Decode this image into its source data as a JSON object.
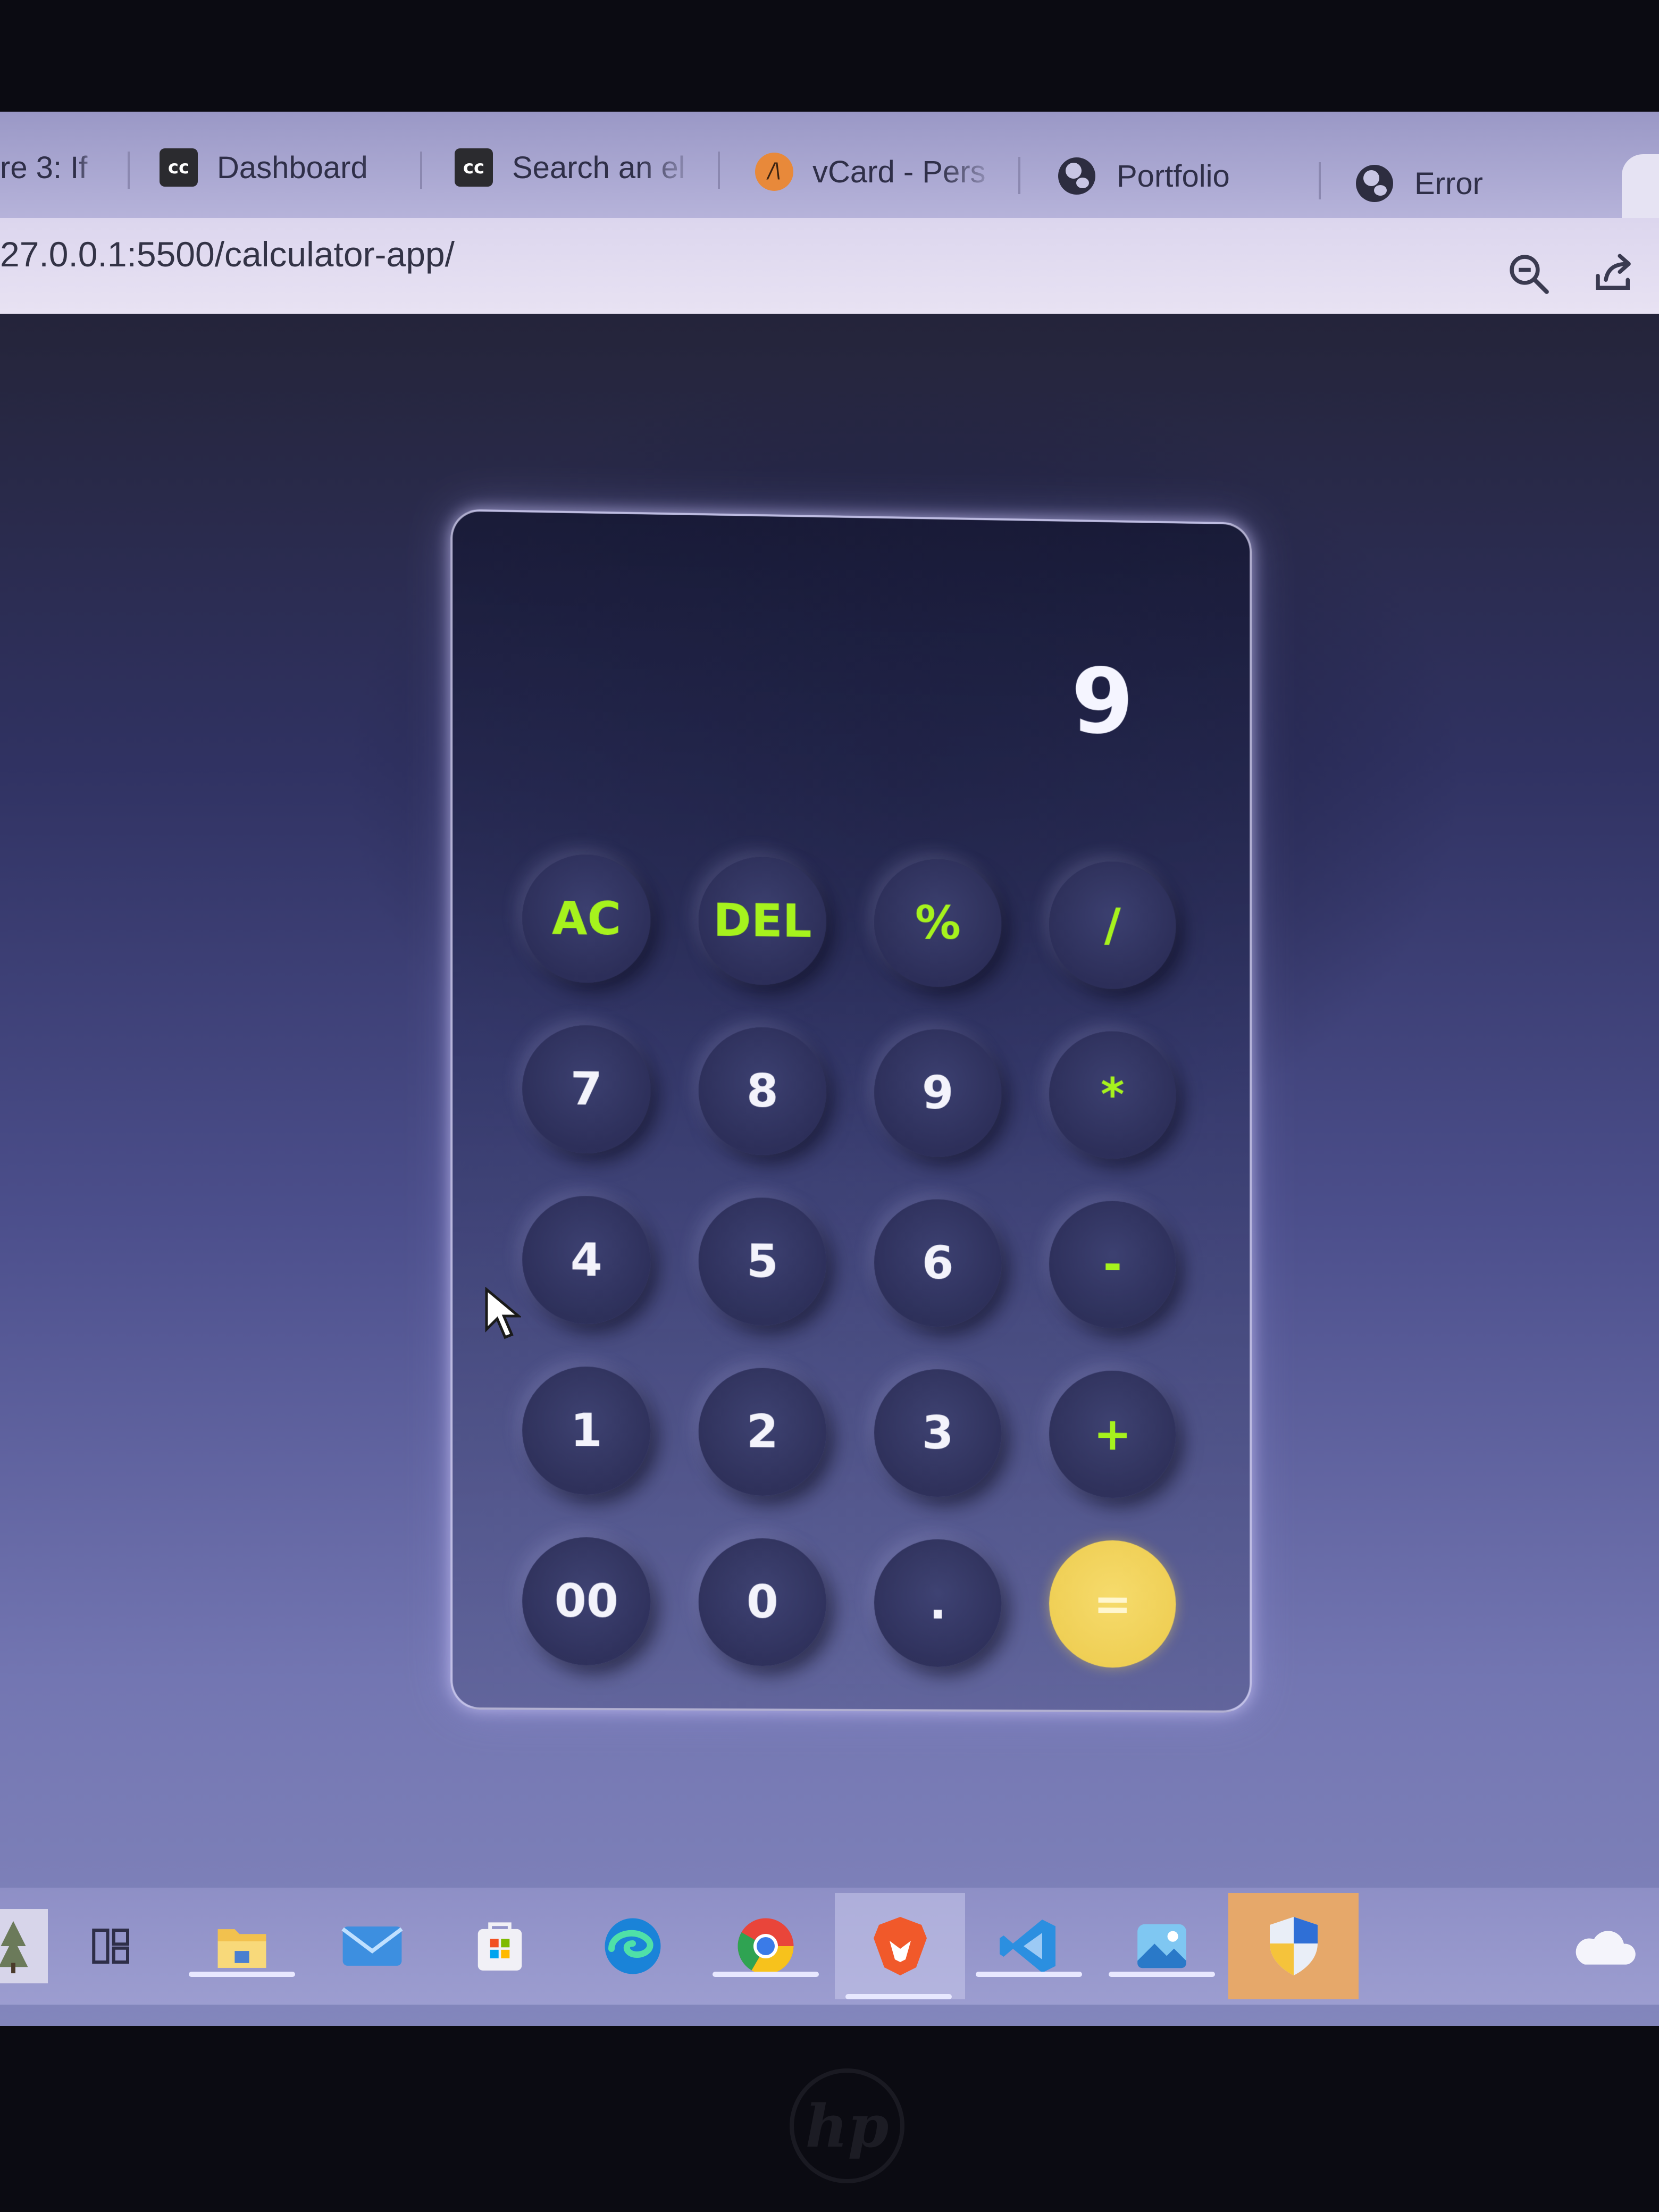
{
  "browser": {
    "tabs": [
      {
        "label": "re 3: If",
        "favicon": "none"
      },
      {
        "label": "Dashboard",
        "favicon": "cc-icon"
      },
      {
        "label": "Search an el",
        "favicon": "cc-icon"
      },
      {
        "label": "vCard - Pers",
        "favicon": "vcard-icon"
      },
      {
        "label": "Portfolio",
        "favicon": "globe-icon"
      },
      {
        "label": "Error",
        "favicon": "globe-icon"
      }
    ],
    "favicon_text": {
      "cc": "cc",
      "vcard": "/\\"
    },
    "url": "27.0.0.1:5500/calculator-app/"
  },
  "calculator": {
    "display": "9",
    "keys": [
      {
        "label": "AC",
        "kind": "op"
      },
      {
        "label": "DEL",
        "kind": "op"
      },
      {
        "label": "%",
        "kind": "op"
      },
      {
        "label": "/",
        "kind": "op"
      },
      {
        "label": "7",
        "kind": "num"
      },
      {
        "label": "8",
        "kind": "num"
      },
      {
        "label": "9",
        "kind": "num"
      },
      {
        "label": "*",
        "kind": "op"
      },
      {
        "label": "4",
        "kind": "num"
      },
      {
        "label": "5",
        "kind": "num"
      },
      {
        "label": "6",
        "kind": "num"
      },
      {
        "label": "-",
        "kind": "op"
      },
      {
        "label": "1",
        "kind": "num"
      },
      {
        "label": "2",
        "kind": "num"
      },
      {
        "label": "3",
        "kind": "num"
      },
      {
        "label": "+",
        "kind": "op"
      },
      {
        "label": "00",
        "kind": "num"
      },
      {
        "label": "0",
        "kind": "num"
      },
      {
        "label": ".",
        "kind": "num"
      },
      {
        "label": "=",
        "kind": "equals"
      }
    ],
    "colors": {
      "operator_text": "#a6f21d",
      "equals_background": "#efcf55",
      "number_text": "#f3f3fb"
    }
  },
  "taskbar": {
    "apps": [
      {
        "icon": "widgets-icon"
      },
      {
        "icon": "task-view-icon"
      },
      {
        "icon": "file-explorer-icon"
      },
      {
        "icon": "mail-icon"
      },
      {
        "icon": "store-icon"
      },
      {
        "icon": "edge-icon"
      },
      {
        "icon": "chrome-icon"
      },
      {
        "icon": "brave-icon"
      },
      {
        "icon": "vscode-icon"
      },
      {
        "icon": "photos-icon"
      },
      {
        "icon": "security-icon"
      },
      {
        "icon": "onedrive-icon"
      }
    ]
  },
  "bezel": {
    "logo": "hp"
  }
}
